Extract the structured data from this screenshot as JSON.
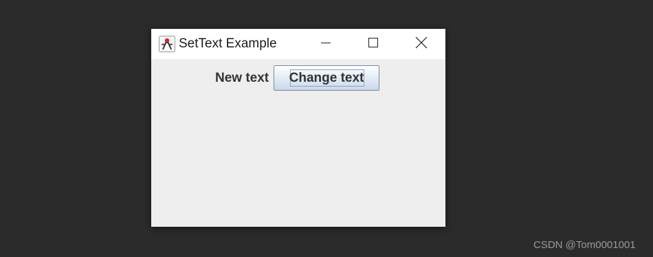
{
  "window": {
    "title": "SetText Example",
    "app_icon": "java-duke-icon",
    "controls": {
      "minimize_icon": "minimize-icon",
      "maximize_icon": "maximize-icon",
      "close_icon": "close-icon"
    }
  },
  "content": {
    "label_text": "New text",
    "button_label": "Change text"
  },
  "watermark": "CSDN @Tom0001001",
  "colors": {
    "desktop_background": "#2b2b2b",
    "titlebar": "#ffffff",
    "window_background": "#eeeeee",
    "text": "#333333"
  }
}
